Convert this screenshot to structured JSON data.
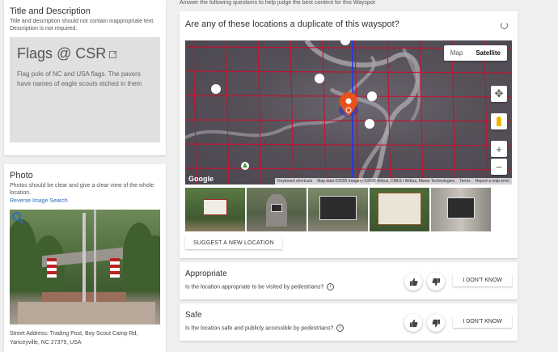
{
  "title_section": {
    "heading": "Title and Description",
    "subtitle": "Title and description should not contain inappropriate text. Description is not required.",
    "title": "Flags @ CSR",
    "description": "Flag pole of NC and USA flags. The pavers have names of eagle scouts etched in them"
  },
  "photo_section": {
    "heading": "Photo",
    "subtitle": "Photos should be clear and give a clear view of the whole location.",
    "reverse_search": "Reverse Image Search",
    "address": "Street Address: Trading Post, Boy Scout Camp Rd, Yanceyville, NC 27379, USA"
  },
  "instructions": "Answer the following questions to help judge the best content for this Wayspot",
  "duplicate": {
    "question": "Are any of these locations a duplicate of this wayspot?",
    "map_tab": "Map",
    "satellite_tab": "Satellite",
    "google": "Google",
    "attribution": [
      "Keyboard shortcuts",
      "Map data ©2025 Imagery ©2025 Airbus, CNES / Airbus, Maxar Technologies",
      "Terms",
      "Report a map error"
    ],
    "suggest_button": "SUGGEST A NEW LOCATION"
  },
  "criteria": [
    {
      "title": "Appropriate",
      "question": "Is the location appropriate to be visited by pedestrians?",
      "dont_know": "I DON'T KNOW"
    },
    {
      "title": "Safe",
      "question": "Is the location safe and publicly accessible by pedestrians?",
      "dont_know": "I DON'T KNOW"
    }
  ],
  "icons": {
    "edit": "edit-icon",
    "refresh": "refresh-icon",
    "info": "i"
  },
  "colors": {
    "link": "#2a6ebb",
    "pin": "#e8521a",
    "grid": "#c8102e"
  }
}
